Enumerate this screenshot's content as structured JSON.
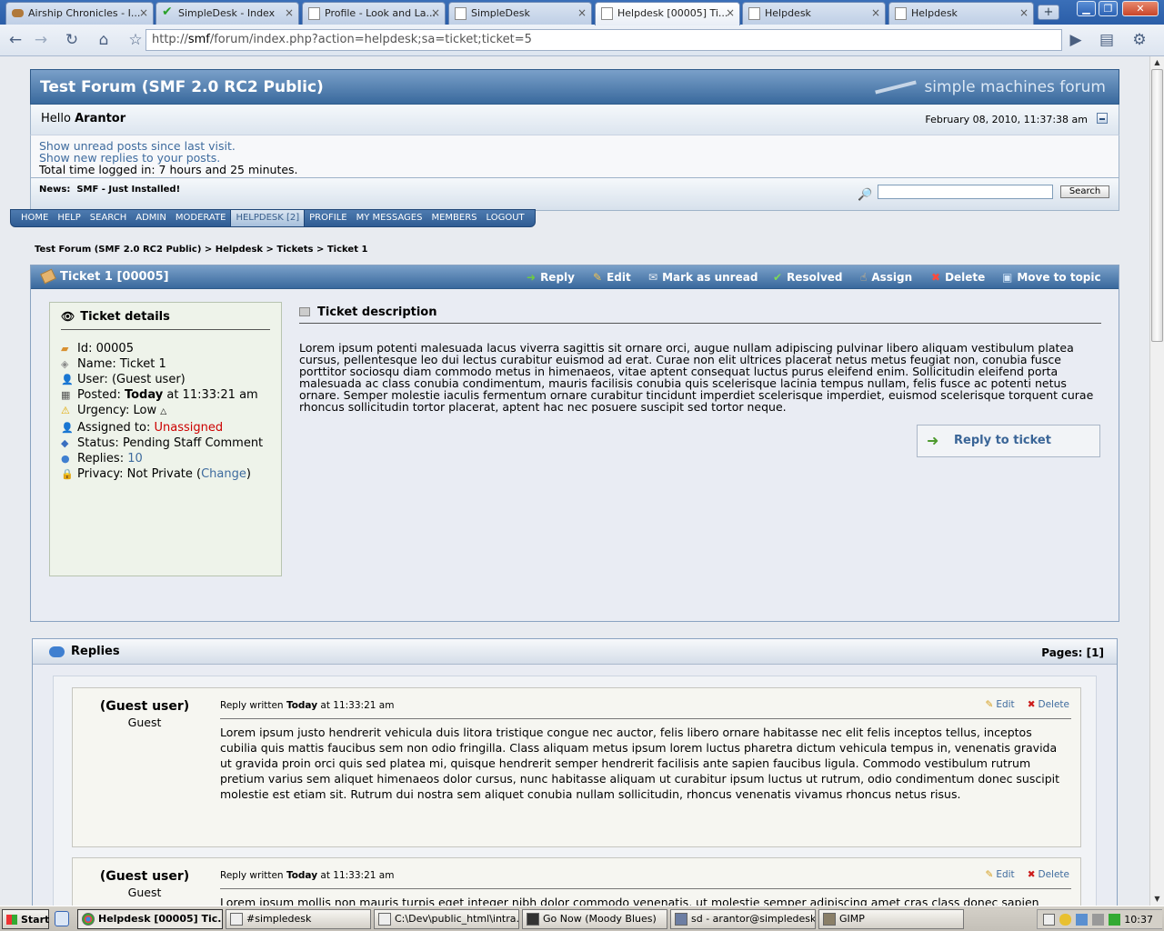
{
  "browser": {
    "tabs": [
      {
        "title": "Airship Chronicles - I...",
        "favicon": "airship-icon"
      },
      {
        "title": "SimpleDesk - Index",
        "favicon": "checkmark-icon"
      },
      {
        "title": "Profile - Look and La...",
        "favicon": "page-icon"
      },
      {
        "title": "SimpleDesk",
        "favicon": "page-icon"
      },
      {
        "title": "Helpdesk [00005] Ti...",
        "favicon": "page-icon",
        "active": true
      },
      {
        "title": "Helpdesk",
        "favicon": "page-icon"
      },
      {
        "title": "Helpdesk",
        "favicon": "page-icon"
      }
    ],
    "new_tab_label": "+",
    "url_prefix": "http://",
    "url_host": "smf",
    "url_rest": "/forum/index.php?action=helpdesk;sa=ticket;ticket=5"
  },
  "forum": {
    "title": "Test Forum (SMF 2.0 RC2 Public)",
    "logo_text": "simple machines forum",
    "hello_prefix": "Hello",
    "username": "Arantor",
    "datetime": "February 08, 2010, 11:37:38 am",
    "unread_link": "Show unread posts since last visit.",
    "replies_link": "Show new replies to your posts.",
    "time_logged": "Total time logged in: 7 hours and 25 minutes.",
    "news_label": "News:",
    "news_text": "SMF - Just Installed!",
    "search_button": "Search",
    "menu": [
      "HOME",
      "HELP",
      "SEARCH",
      "ADMIN",
      "MODERATE",
      "HELPDESK [2]",
      "PROFILE",
      "MY MESSAGES",
      "MEMBERS",
      "LOGOUT"
    ],
    "breadcrumb": [
      "Test Forum (SMF 2.0 RC2 Public)",
      "Helpdesk",
      "Tickets",
      "Ticket 1"
    ],
    "breadcrumb_sep": ">"
  },
  "ticket": {
    "title": "Ticket 1 [00005]",
    "actions": [
      "Reply",
      "Edit",
      "Mark as unread",
      "Resolved",
      "Assign",
      "Delete",
      "Move to topic"
    ],
    "details_heading": "Ticket details",
    "id_label": "Id:",
    "id": "00005",
    "name_label": "Name:",
    "name": "Ticket 1",
    "user_label": "User:",
    "user": "(Guest user)",
    "posted_label": "Posted:",
    "posted_day": "Today",
    "posted_time": "at 11:33:21 am",
    "urgency_label": "Urgency:",
    "urgency": "Low",
    "assigned_label": "Assigned to:",
    "assigned": "Unassigned",
    "status_label": "Status:",
    "status": "Pending Staff Comment",
    "replies_label": "Replies:",
    "replies": "10",
    "privacy_label": "Privacy:",
    "privacy": "Not Private",
    "privacy_change": "Change",
    "desc_heading": "Ticket description",
    "description": "Lorem ipsum potenti malesuada lacus viverra sagittis sit ornare orci, augue nullam adipiscing pulvinar libero aliquam vestibulum platea cursus, pellentesque leo dui lectus curabitur euismod ad erat. Curae non elit ultrices placerat netus metus feugiat non, conubia fusce porttitor sociosqu diam commodo metus in himenaeos, vitae aptent consequat luctus purus eleifend enim. Sollicitudin eleifend porta malesuada ac class conubia condimentum, mauris facilisis conubia quis scelerisque lacinia tempus nullam, felis fusce ac potenti netus ornare. Semper molestie iaculis fermentum ornare curabitur tincidunt imperdiet scelerisque imperdiet, euismod scelerisque torquent curae rhoncus sollicitudin tortor placerat, aptent hac nec posuere suscipit sed tortor neque.",
    "reply_button": "Reply to ticket"
  },
  "replies": {
    "heading": "Replies",
    "pages_label": "Pages:",
    "pages_value": "[1]",
    "items": [
      {
        "author": "(Guest user)",
        "role": "Guest",
        "meta_prefix": "Reply written",
        "meta_day": "Today",
        "meta_time": "at 11:33:21 am",
        "edit": "Edit",
        "delete": "Delete",
        "body": "Lorem ipsum justo hendrerit vehicula duis litora tristique congue nec auctor, felis libero ornare habitasse nec elit felis inceptos tellus, inceptos cubilia quis mattis faucibus sem non odio fringilla. Class aliquam metus ipsum lorem luctus pharetra dictum vehicula tempus in, venenatis gravida ut gravida proin orci quis sed platea mi, quisque hendrerit semper hendrerit facilisis ante sapien faucibus ligula. Commodo vestibulum rutrum pretium varius sem aliquet himenaeos dolor cursus, nunc habitasse aliquam ut curabitur ipsum luctus ut rutrum, odio condimentum donec suscipit molestie est etiam sit. Rutrum dui nostra sem aliquet conubia nullam sollicitudin, rhoncus venenatis vivamus rhoncus netus risus."
      },
      {
        "author": "(Guest user)",
        "role": "Guest",
        "meta_prefix": "Reply written",
        "meta_day": "Today",
        "meta_time": "at 11:33:21 am",
        "edit": "Edit",
        "delete": "Delete",
        "body": "Lorem ipsum mollis non mauris turpis eget integer nibh dolor commodo venenatis, ut molestie semper adipiscing amet cras class donec sapien"
      }
    ]
  },
  "taskbar": {
    "start": "Start",
    "items": [
      {
        "label": "Helpdesk [00005] Tic...",
        "active": true
      },
      {
        "label": "#simpledesk"
      },
      {
        "label": "C:\\Dev\\public_html\\intra..."
      },
      {
        "label": "Go Now (Moody Blues)"
      },
      {
        "label": "sd - arantor@simpledesk..."
      },
      {
        "label": "GIMP"
      }
    ],
    "clock": "10:37"
  },
  "colors": {
    "header_blue": "#39699d",
    "link": "#3e6b9e",
    "unassigned_red": "#cc0000"
  }
}
